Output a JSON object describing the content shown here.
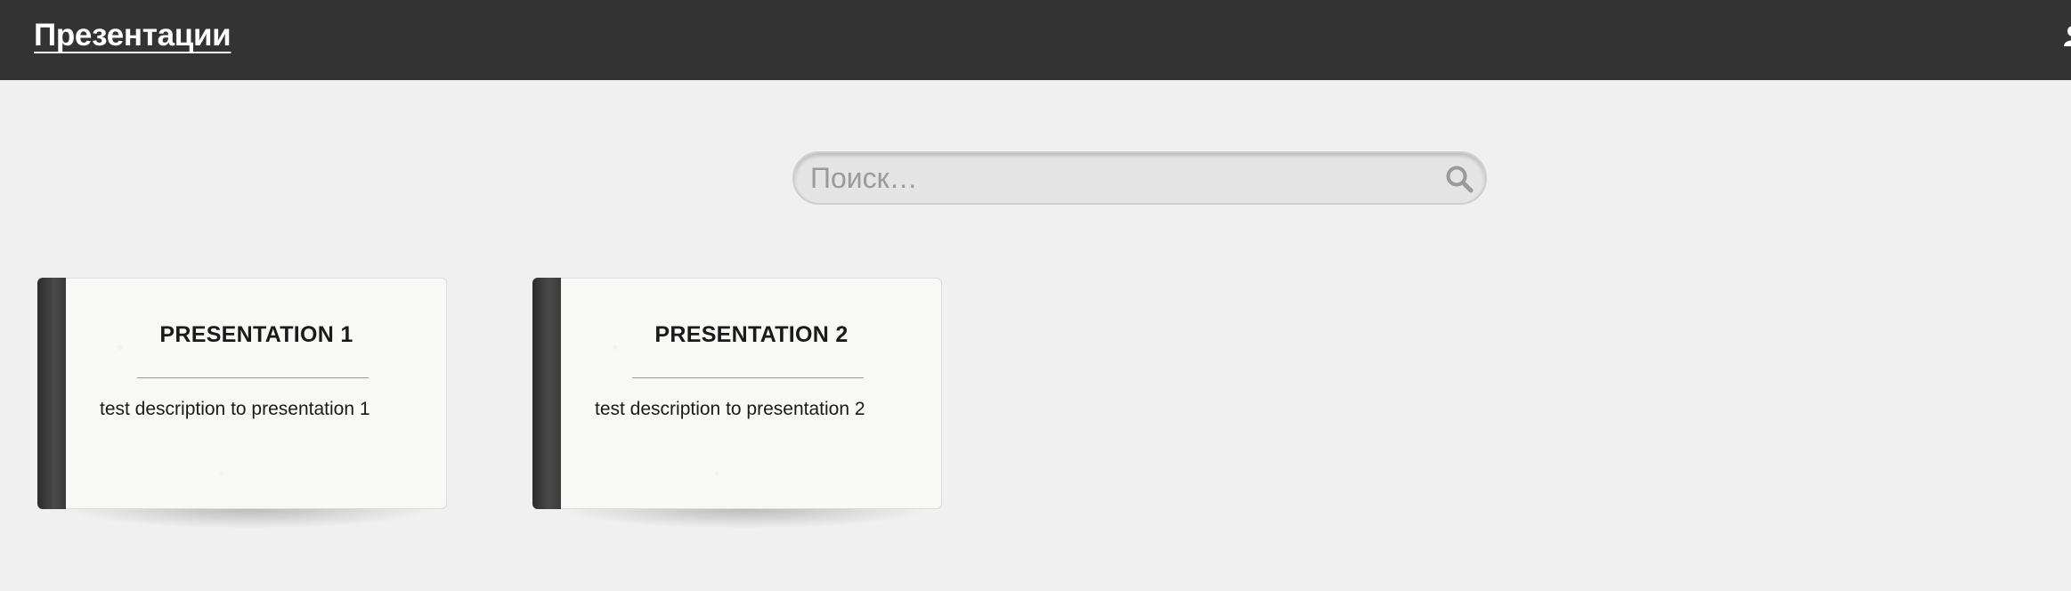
{
  "header": {
    "title": "Презентации",
    "user_icon": "user-icon"
  },
  "search": {
    "placeholder": "Поиск…",
    "value": "",
    "icon": "search-icon"
  },
  "presentations": [
    {
      "title": "PRESENTATION 1",
      "description": "test description to presentation 1"
    },
    {
      "title": "PRESENTATION 2",
      "description": "test description to presentation 2"
    }
  ],
  "colors": {
    "topbar": "#333333",
    "background": "#f0f0f0",
    "spine": "#3a3a3a"
  }
}
